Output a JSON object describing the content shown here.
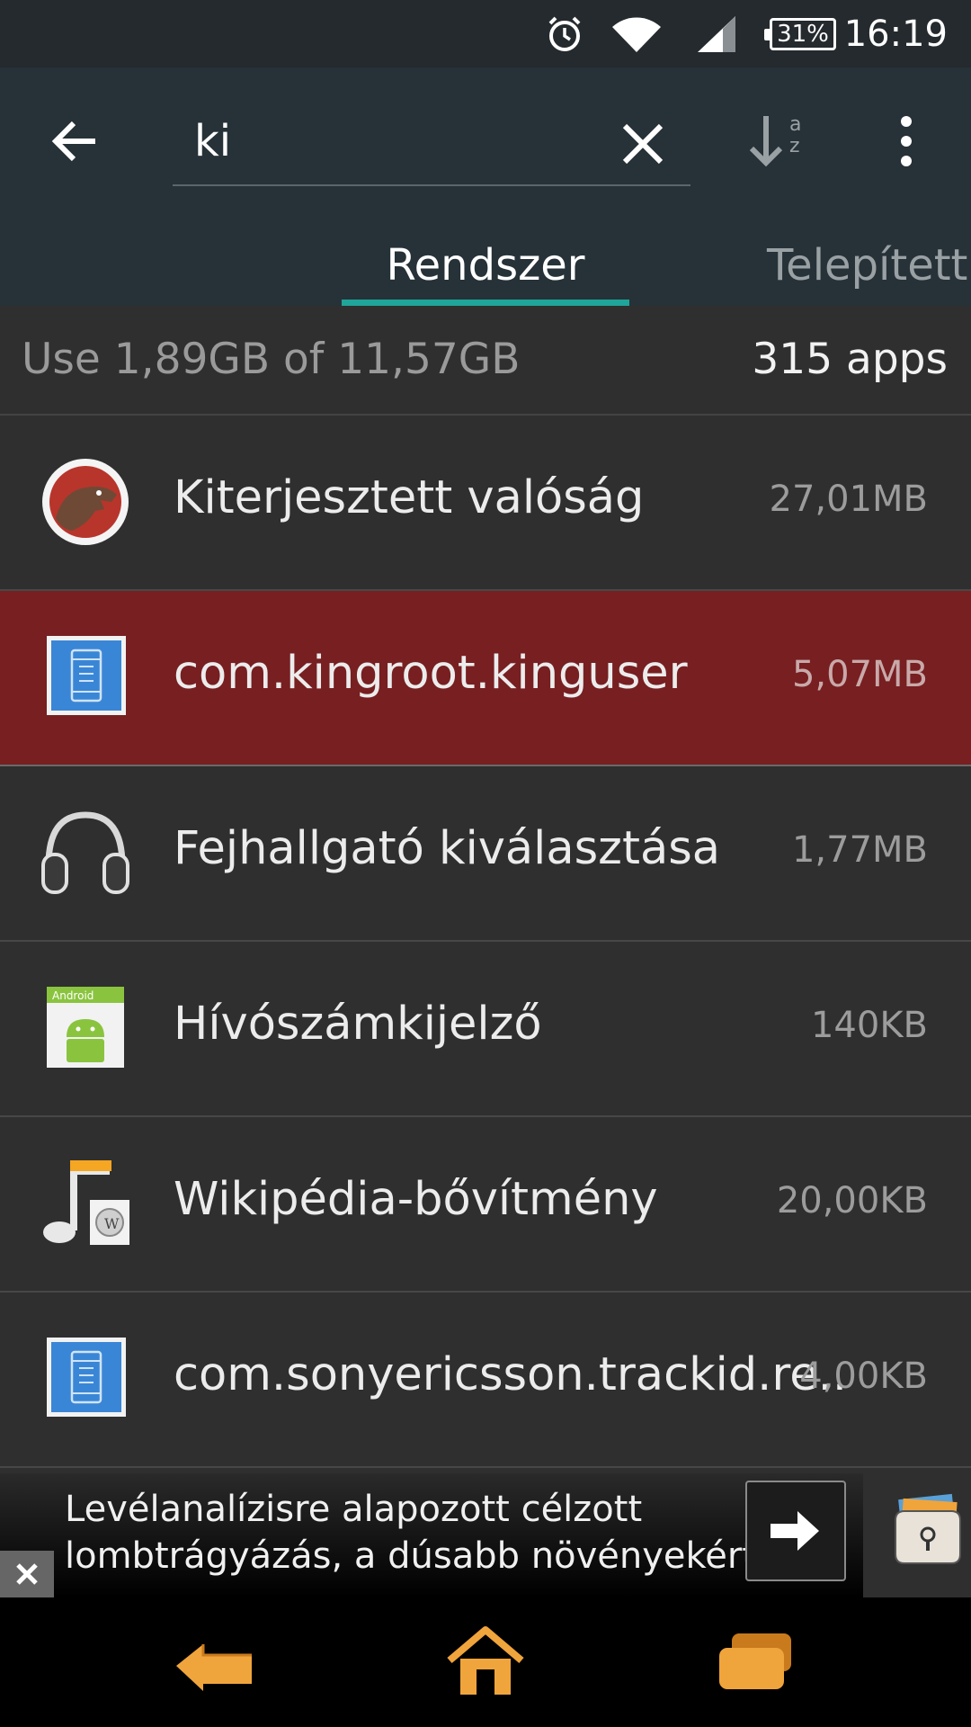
{
  "status_bar": {
    "time": "16:19",
    "battery_percent": "31%",
    "icons": [
      "alarm-icon",
      "wifi-icon",
      "signal-icon",
      "battery-icon"
    ]
  },
  "toolbar": {
    "search": {
      "value": "ki"
    },
    "tabs": [
      {
        "label": "Rendszer",
        "active": true
      },
      {
        "label": "Telepített",
        "active": false
      }
    ],
    "icons": [
      "arrow-left-icon",
      "close-icon",
      "sort-alpha-icon",
      "more-vert-icon"
    ]
  },
  "summary": {
    "usage": "Use 1,89GB of 11,57GB",
    "count": "315 apps"
  },
  "apps": [
    {
      "name": "Kiterjesztett valóság",
      "size": "27,01MB",
      "icon": "dinosaur-icon",
      "highlighted": false
    },
    {
      "name": "com.kingroot.kinguser",
      "size": "5,07MB",
      "icon": "blueprint-icon",
      "highlighted": true
    },
    {
      "name": "Fejhallgató kiválasztása",
      "size": "1,77MB",
      "icon": "headphones-icon",
      "highlighted": false
    },
    {
      "name": "Hívószámkijelző",
      "size": "140KB",
      "icon": "android-icon",
      "highlighted": false
    },
    {
      "name": "Wikipédia-bővítmény",
      "size": "20,00KB",
      "icon": "music-wiki-icon",
      "highlighted": false
    },
    {
      "name": "com.sonyericsson.trackid.re..",
      "size": "4,00KB",
      "icon": "blueprint-icon",
      "highlighted": false
    }
  ],
  "ad": {
    "line1": "Levélanalízisre alapozott célzott",
    "line2": "lombtrágyázás, a dúsabb növényekért"
  },
  "colors": {
    "toolbar_bg": "#263238",
    "accent": "#1fa59a",
    "highlight_row": "#771f21",
    "nav_orange": "#f0a43c"
  }
}
